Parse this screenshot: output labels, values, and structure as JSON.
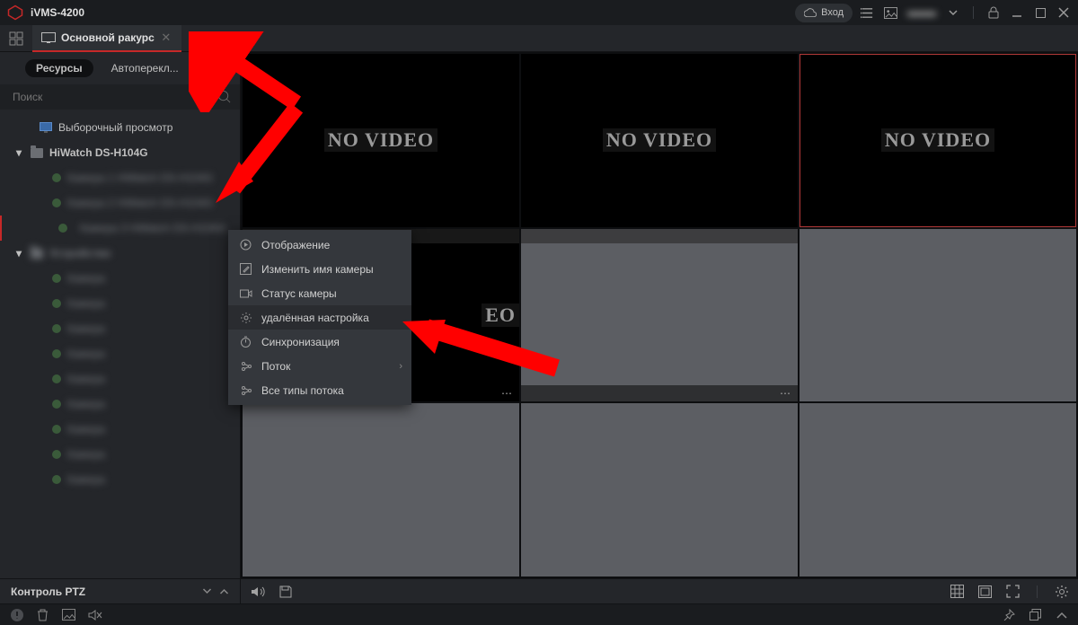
{
  "app": {
    "title": "iVMS-4200"
  },
  "titlebar": {
    "login": "Вход"
  },
  "tabs": {
    "main": {
      "label": "Основной ракурс"
    }
  },
  "sidebar": {
    "pills": {
      "resources": "Ресурсы",
      "autoswitch": "Автоперекл..."
    },
    "search_placeholder": "Поиск",
    "selective_view": "Выборочный просмотр",
    "device1": "HiWatch DS-H104G",
    "cams1": [
      "Камера 1  HiWatch DS-H104G",
      "Камера 2  HiWatch DS-H104G",
      "Камера 3  HiWatch DS-H104G"
    ],
    "device2": "Устройство",
    "cams2": [
      "Камера",
      "Камера",
      "Камера",
      "Камера",
      "Камера",
      "Камера",
      "Камера",
      "Камера",
      "Камера"
    ]
  },
  "context_menu": {
    "display": "Отображение",
    "rename": "Изменить имя камеры",
    "status": "Статус камеры",
    "remote": "удалённая настройка",
    "sync": "Синхронизация",
    "stream": "Поток",
    "all_streams": "Все типы потока"
  },
  "video": {
    "no_video": "NO VIDEO",
    "partial": "EO"
  },
  "bottom": {
    "ptz": "Контроль PTZ"
  },
  "colors": {
    "accent": "#c62828",
    "arrow": "#ff0000"
  }
}
